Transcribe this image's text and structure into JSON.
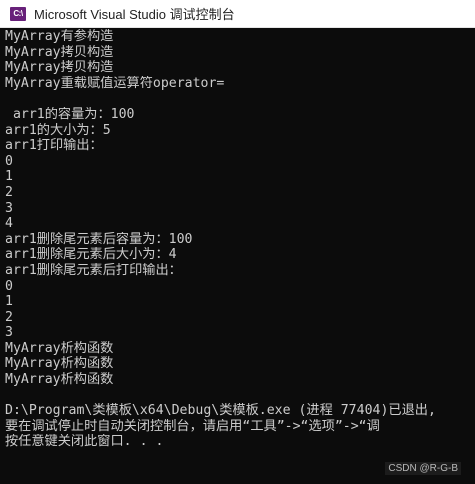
{
  "window": {
    "icon_text": "C:\\",
    "title": "Microsoft Visual Studio 调试控制台"
  },
  "console": {
    "lines": [
      "MyArray有参构造",
      "MyArray拷贝构造",
      "MyArray拷贝构造",
      "MyArray重载赋值运算符operator=",
      "",
      " arr1的容量为：100",
      "arr1的大小为：5",
      "arr1打印输出：",
      "0",
      "1",
      "2",
      "3",
      "4",
      "arr1删除尾元素后容量为：100",
      "arr1删除尾元素后大小为：4",
      "arr1删除尾元素后打印输出：",
      "0",
      "1",
      "2",
      "3",
      "MyArray析构函数",
      "MyArray析构函数",
      "MyArray析构函数",
      "",
      "D:\\Program\\类模板\\x64\\Debug\\类模板.exe (进程 77404)已退出,",
      "要在调试停止时自动关闭控制台，请启用“工具”->“选项”->“调",
      "按任意键关闭此窗口. . ."
    ]
  },
  "watermark": "CSDN @R-G-B",
  "colors": {
    "console_bg": "#0c0c0c",
    "console_fg": "#cccccc",
    "titlebar_bg": "#ffffff",
    "icon_bg": "#68217a"
  }
}
